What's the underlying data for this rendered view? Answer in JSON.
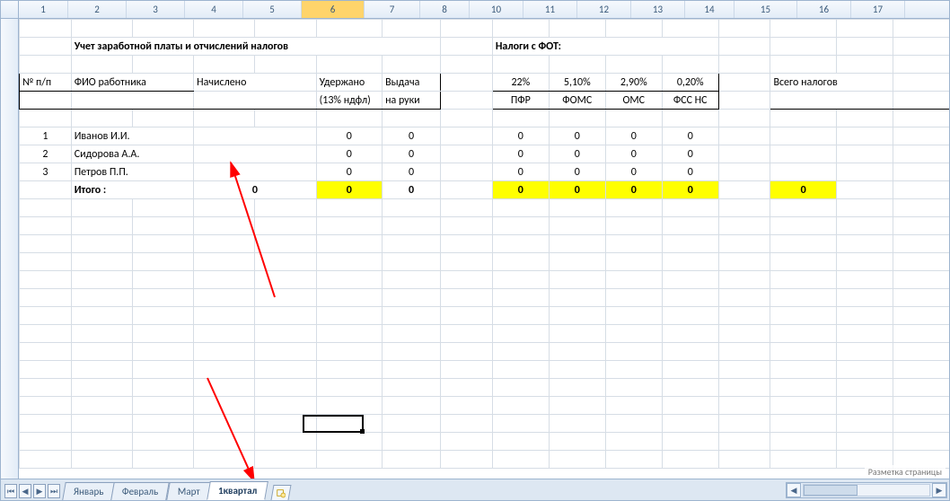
{
  "columns": [
    "1",
    "2",
    "3",
    "4",
    "5",
    "6",
    "7",
    "8",
    "10",
    "11",
    "12",
    "13",
    "14",
    "15",
    "16",
    "17"
  ],
  "selected_column_index": 5,
  "titles": {
    "main": "Учет заработной платы и отчислений налогов",
    "taxes": "Налоги с ФОТ:"
  },
  "headers": {
    "npp": "№ п/п",
    "fio": "ФИО работника",
    "accrued": "Начислено",
    "withheld": "Удержано (13% ндфл)",
    "payout": "Выдача на руки",
    "totaltax": "Всего налогов"
  },
  "tax_cols": {
    "rates": [
      "22%",
      "5,10%",
      "2,90%",
      "0,20%"
    ],
    "names": [
      "ПФР",
      "ФОМС",
      "ОМС",
      "ФСС НС"
    ]
  },
  "rows": [
    {
      "n": "1",
      "fio": "Иванов И.И.",
      "accrued": "",
      "withheld": "0",
      "payout": "0",
      "t": [
        "0",
        "0",
        "0",
        "0"
      ],
      "total": ""
    },
    {
      "n": "2",
      "fio": "Сидорова А.А.",
      "accrued": "",
      "withheld": "0",
      "payout": "0",
      "t": [
        "0",
        "0",
        "0",
        "0"
      ],
      "total": ""
    },
    {
      "n": "3",
      "fio": "Петров П.П.",
      "accrued": "",
      "withheld": "0",
      "payout": "0",
      "t": [
        "0",
        "0",
        "0",
        "0"
      ],
      "total": ""
    }
  ],
  "totals": {
    "label": "Итого :",
    "accrued": "0",
    "withheld": "0",
    "payout": "0",
    "t": [
      "0",
      "0",
      "0",
      "0"
    ],
    "total": "0"
  },
  "tabs": {
    "items": [
      "Январь",
      "Февраль",
      "Март",
      "1квартал"
    ],
    "active_index": 3
  },
  "status_hint": "Разметка страницы"
}
